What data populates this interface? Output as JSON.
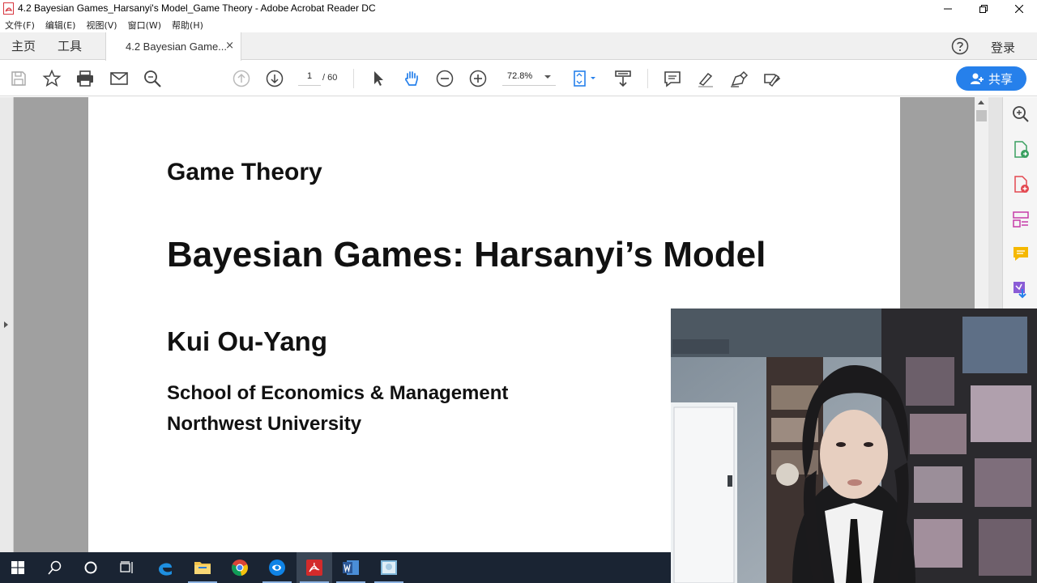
{
  "window": {
    "title": "4.2 Bayesian Games_Harsanyi's Model_Game Theory - Adobe Acrobat Reader DC"
  },
  "menu": {
    "items": [
      {
        "label": "文件(F)"
      },
      {
        "label": "编辑(E)"
      },
      {
        "label": "视图(V)"
      },
      {
        "label": "窗口(W)"
      },
      {
        "label": "帮助(H)"
      }
    ]
  },
  "tabs": {
    "home": "主页",
    "tools": "工具",
    "document": "4.2 Bayesian Game...",
    "close": "×",
    "login": "登录"
  },
  "toolbar": {
    "page_current": "1",
    "page_total": "/ 60",
    "zoom": "72.8%",
    "share_label": "共享"
  },
  "document": {
    "course_title": "Game Theory",
    "lecture_title": "Bayesian Games: Harsanyi’s Model",
    "author": "Kui Ou-Yang",
    "school": "School of Economics & Management",
    "university": "Northwest University"
  },
  "colors": {
    "accent": "#2680eb",
    "canvas": "#a0a0a0",
    "taskbar": "#1a2433"
  }
}
